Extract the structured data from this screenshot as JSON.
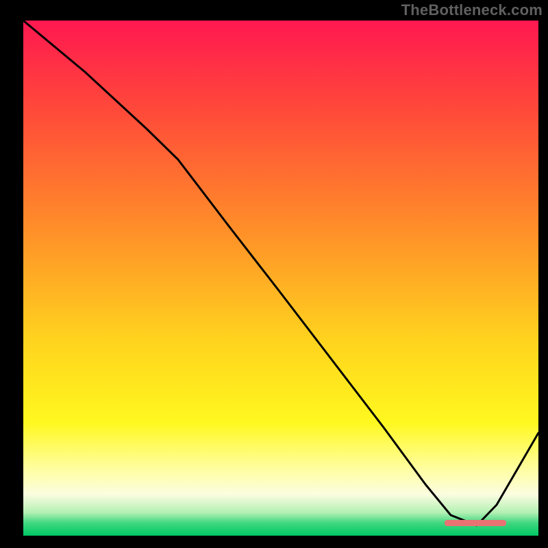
{
  "attribution": "TheBottleneck.com",
  "chart_data": {
    "type": "line",
    "title": "",
    "xlabel": "",
    "ylabel": "",
    "xlim": [
      0,
      100
    ],
    "ylim": [
      0,
      100
    ],
    "background_gradient": {
      "stops": [
        {
          "offset": 0.0,
          "color": "#ff1850"
        },
        {
          "offset": 0.18,
          "color": "#ff4b39"
        },
        {
          "offset": 0.4,
          "color": "#ff8d29"
        },
        {
          "offset": 0.62,
          "color": "#ffd31e"
        },
        {
          "offset": 0.78,
          "color": "#fff81f"
        },
        {
          "offset": 0.87,
          "color": "#fffea0"
        },
        {
          "offset": 0.92,
          "color": "#fbfde0"
        },
        {
          "offset": 0.955,
          "color": "#b4f0b4"
        },
        {
          "offset": 0.975,
          "color": "#40d880"
        },
        {
          "offset": 1.0,
          "color": "#00c864"
        }
      ]
    },
    "series": [
      {
        "name": "bottleneck-curve",
        "color": "#000000",
        "x": [
          0,
          12,
          24,
          30,
          40,
          50,
          60,
          70,
          78,
          83,
          88,
          92,
          100
        ],
        "y": [
          100,
          90,
          79,
          73,
          60,
          47,
          34,
          21,
          10,
          4,
          2,
          6,
          20
        ]
      }
    ],
    "marker": {
      "name": "optimal-range",
      "color": "#e97273",
      "x_start": 80,
      "x_end": 92,
      "y": 2
    },
    "grid": false,
    "legend": false
  }
}
